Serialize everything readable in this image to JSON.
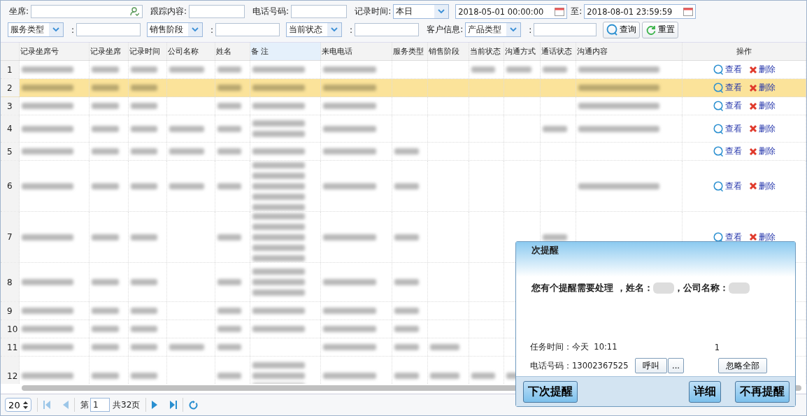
{
  "filters": [
    [
      {
        "kind": "label",
        "text": "坐席:"
      },
      {
        "kind": "user_input"
      },
      {
        "kind": "label",
        "text": "跟踪内容:"
      },
      {
        "kind": "input"
      },
      {
        "kind": "label",
        "text": "电话号码:"
      },
      {
        "kind": "input"
      },
      {
        "kind": "label",
        "text": "记录时间:"
      },
      {
        "kind": "select",
        "value": "本日"
      },
      {
        "kind": "date",
        "value": "2018-05-01 00:00:00"
      },
      {
        "kind": "label",
        "text": "至:"
      },
      {
        "kind": "date",
        "value": "2018-08-01 23:59:59"
      }
    ],
    [
      {
        "kind": "select",
        "value": "服务类型"
      },
      {
        "kind": "label",
        "text": ":"
      },
      {
        "kind": "input"
      },
      {
        "kind": "select",
        "value": "销售阶段"
      },
      {
        "kind": "label",
        "text": ":"
      },
      {
        "kind": "input"
      },
      {
        "kind": "select",
        "value": "当前状态"
      },
      {
        "kind": "label",
        "text": ":"
      },
      {
        "kind": "input"
      },
      {
        "kind": "label",
        "text": "客户信息:"
      },
      {
        "kind": "select",
        "value": "产品类型"
      },
      {
        "kind": "label",
        "text": ":"
      },
      {
        "kind": "input"
      },
      {
        "kind": "search_button",
        "text": "查询"
      },
      {
        "kind": "reset_button",
        "text": "重置"
      }
    ]
  ],
  "table": {
    "columns": [
      {
        "label": "记录坐席号",
        "selected": false
      },
      {
        "label": "记录坐席",
        "selected": false
      },
      {
        "label": "记录时间",
        "selected": false
      },
      {
        "label": "公司名称",
        "selected": false
      },
      {
        "label": "姓名",
        "selected": false
      },
      {
        "label": "备 注",
        "selected": true
      },
      {
        "label": "来电电话",
        "selected": false
      },
      {
        "label": "服务类型",
        "selected": false
      },
      {
        "label": "销售阶段",
        "selected": false
      },
      {
        "label": "当前状态",
        "selected": false
      },
      {
        "label": "沟通方式",
        "selected": false
      },
      {
        "label": "通话状态",
        "selected": false
      },
      {
        "label": "沟通内容",
        "selected": false
      },
      {
        "label": "操作",
        "selected": false
      }
    ],
    "rows": [
      {
        "num": "1",
        "selected": false,
        "kind": "single",
        "cells": [
          {
            "kind": "blurred"
          },
          {
            "kind": "blurred"
          },
          {
            "kind": "blurred"
          },
          {
            "kind": "blurred"
          },
          {
            "kind": "blurred"
          },
          {
            "kind": "blurred"
          },
          {
            "kind": "blurred"
          },
          {
            "kind": "empty"
          },
          {
            "kind": "empty"
          },
          {
            "kind": "blurred"
          },
          {
            "kind": "blurred"
          },
          {
            "kind": "blurred"
          },
          {
            "kind": "blurred"
          }
        ],
        "actions": [
          {
            "kind": "view",
            "label": "查看"
          },
          {
            "kind": "delete",
            "label": "删除"
          }
        ]
      },
      {
        "num": "2",
        "selected": true,
        "kind": "single",
        "cells": [
          {
            "kind": "blurred"
          },
          {
            "kind": "blurred"
          },
          {
            "kind": "blurred"
          },
          {
            "kind": "empty"
          },
          {
            "kind": "blurred"
          },
          {
            "kind": "blurred"
          },
          {
            "kind": "blurred"
          },
          {
            "kind": "empty"
          },
          {
            "kind": "empty"
          },
          {
            "kind": "empty"
          },
          {
            "kind": "empty"
          },
          {
            "kind": "empty"
          },
          {
            "kind": "blurred"
          }
        ],
        "actions": [
          {
            "kind": "view",
            "label": "查看"
          },
          {
            "kind": "delete",
            "label": "删除"
          }
        ]
      },
      {
        "num": "3",
        "selected": false,
        "kind": "single",
        "cells": [
          {
            "kind": "blurred"
          },
          {
            "kind": "blurred"
          },
          {
            "kind": "blurred"
          },
          {
            "kind": "empty"
          },
          {
            "kind": "blurred"
          },
          {
            "kind": "blurred"
          },
          {
            "kind": "blurred"
          },
          {
            "kind": "empty"
          },
          {
            "kind": "empty"
          },
          {
            "kind": "empty"
          },
          {
            "kind": "empty"
          },
          {
            "kind": "empty"
          },
          {
            "kind": "blurred"
          }
        ],
        "actions": [
          {
            "kind": "view",
            "label": "查看"
          },
          {
            "kind": "delete",
            "label": "删除"
          }
        ]
      },
      {
        "num": "4",
        "selected": false,
        "kind": "double",
        "cells": [
          {
            "kind": "blurred"
          },
          {
            "kind": "blurred"
          },
          {
            "kind": "blurred"
          },
          {
            "kind": "blurred"
          },
          {
            "kind": "blurred"
          },
          {
            "kind": "blurred"
          },
          {
            "kind": "blurred"
          },
          {
            "kind": "empty"
          },
          {
            "kind": "empty"
          },
          {
            "kind": "empty"
          },
          {
            "kind": "empty"
          },
          {
            "kind": "blurred"
          },
          {
            "kind": "blurred"
          }
        ],
        "actions": [
          {
            "kind": "view",
            "label": "查看"
          },
          {
            "kind": "delete",
            "label": "删除"
          }
        ]
      },
      {
        "num": "5",
        "selected": false,
        "kind": "single",
        "cells": [
          {
            "kind": "blurred"
          },
          {
            "kind": "blurred"
          },
          {
            "kind": "blurred"
          },
          {
            "kind": "blurred"
          },
          {
            "kind": "blurred"
          },
          {
            "kind": "blurred"
          },
          {
            "kind": "blurred"
          },
          {
            "kind": "blurred"
          },
          {
            "kind": "empty"
          },
          {
            "kind": "empty"
          },
          {
            "kind": "empty"
          },
          {
            "kind": "empty"
          },
          {
            "kind": "empty"
          }
        ],
        "actions": [
          {
            "kind": "view",
            "label": "查看"
          },
          {
            "kind": "delete",
            "label": "删除"
          }
        ]
      },
      {
        "num": "6",
        "selected": false,
        "kind": "quintuple",
        "cells": [
          {
            "kind": "blurred"
          },
          {
            "kind": "blurred"
          },
          {
            "kind": "blurred"
          },
          {
            "kind": "blurred"
          },
          {
            "kind": "blurred"
          },
          {
            "kind": "blurred"
          },
          {
            "kind": "blurred"
          },
          {
            "kind": "blurred"
          },
          {
            "kind": "empty"
          },
          {
            "kind": "empty"
          },
          {
            "kind": "empty"
          },
          {
            "kind": "empty"
          },
          {
            "kind": "blurred"
          }
        ],
        "actions": [
          {
            "kind": "view",
            "label": "查看"
          },
          {
            "kind": "delete",
            "label": "删除"
          }
        ]
      },
      {
        "num": "7",
        "selected": false,
        "kind": "quintuple",
        "cells": [
          {
            "kind": "blurred"
          },
          {
            "kind": "blurred"
          },
          {
            "kind": "blurred"
          },
          {
            "kind": "empty"
          },
          {
            "kind": "blurred"
          },
          {
            "kind": "blurred"
          },
          {
            "kind": "blurred"
          },
          {
            "kind": "blurred"
          },
          {
            "kind": "empty"
          },
          {
            "kind": "empty"
          },
          {
            "kind": "empty"
          },
          {
            "kind": "blurred"
          },
          {
            "kind": "empty"
          }
        ],
        "actions": [
          {
            "kind": "view",
            "label": "查看"
          },
          {
            "kind": "delete",
            "label": "删除"
          }
        ]
      },
      {
        "num": "8",
        "selected": false,
        "kind": "triple",
        "cells": [
          {
            "kind": "blurred"
          },
          {
            "kind": "blurred"
          },
          {
            "kind": "blurred"
          },
          {
            "kind": "empty"
          },
          {
            "kind": "blurred"
          },
          {
            "kind": "blurred"
          },
          {
            "kind": "blurred"
          },
          {
            "kind": "blurred"
          },
          {
            "kind": "empty"
          },
          {
            "kind": "empty"
          },
          {
            "kind": "empty"
          },
          {
            "kind": "empty"
          },
          {
            "kind": "empty"
          }
        ]
      },
      {
        "num": "9",
        "selected": false,
        "kind": "single",
        "cells": [
          {
            "kind": "blurred"
          },
          {
            "kind": "blurred"
          },
          {
            "kind": "blurred"
          },
          {
            "kind": "empty"
          },
          {
            "kind": "blurred"
          },
          {
            "kind": "blurred"
          },
          {
            "kind": "blurred"
          },
          {
            "kind": "blurred"
          },
          {
            "kind": "empty"
          },
          {
            "kind": "empty"
          },
          {
            "kind": "empty"
          },
          {
            "kind": "empty"
          },
          {
            "kind": "empty"
          }
        ]
      },
      {
        "num": "10",
        "selected": false,
        "kind": "single",
        "cells": [
          {
            "kind": "blurred"
          },
          {
            "kind": "blurred"
          },
          {
            "kind": "blurred"
          },
          {
            "kind": "empty"
          },
          {
            "kind": "blurred"
          },
          {
            "kind": "blurred"
          },
          {
            "kind": "blurred"
          },
          {
            "kind": "blurred"
          },
          {
            "kind": "empty"
          },
          {
            "kind": "empty"
          },
          {
            "kind": "empty"
          },
          {
            "kind": "empty"
          },
          {
            "kind": "empty"
          }
        ]
      },
      {
        "num": "11",
        "selected": false,
        "kind": "single",
        "cells": [
          {
            "kind": "blurred"
          },
          {
            "kind": "blurred"
          },
          {
            "kind": "blurred"
          },
          {
            "kind": "blurred"
          },
          {
            "kind": "blurred"
          },
          {
            "kind": "empty"
          },
          {
            "kind": "blurred"
          },
          {
            "kind": "blurred"
          },
          {
            "kind": "blurred"
          },
          {
            "kind": "empty"
          },
          {
            "kind": "empty"
          },
          {
            "kind": "empty"
          },
          {
            "kind": "empty"
          }
        ]
      },
      {
        "num": "12",
        "selected": false,
        "kind": "triple",
        "cells": [
          {
            "kind": "blurred"
          },
          {
            "kind": "blurred"
          },
          {
            "kind": "blurred"
          },
          {
            "kind": "empty"
          },
          {
            "kind": "blurred"
          },
          {
            "kind": "blurred"
          },
          {
            "kind": "blurred"
          },
          {
            "kind": "blurred"
          },
          {
            "kind": "blurred"
          },
          {
            "kind": "blurred"
          },
          {
            "kind": "blurred"
          },
          {
            "kind": "empty"
          },
          {
            "kind": "empty"
          }
        ]
      }
    ]
  },
  "pager": {
    "page_size": "20",
    "page_label": "第",
    "page": "1",
    "total": "共32页"
  },
  "reminder": {
    "title": "次提醒",
    "message": [
      {
        "kind": "text",
        "text": "您有个提醒需要处理 ，姓名："
      },
      {
        "kind": "hidden"
      },
      {
        "kind": "text",
        "text": "，公司名称："
      },
      {
        "kind": "hidden"
      }
    ],
    "task_time": "任务时间：今天  10:11",
    "count": "1",
    "phone": "电话号码：13002367525",
    "inline_buttons": [
      "呼叫",
      "..."
    ],
    "ignore_button": "忽略全部",
    "footer_buttons": [
      {
        "kind": "left",
        "label": "下次提醒"
      },
      {
        "kind": "right",
        "label": "详细"
      },
      {
        "kind": "right",
        "label": "不再提醒"
      }
    ]
  }
}
